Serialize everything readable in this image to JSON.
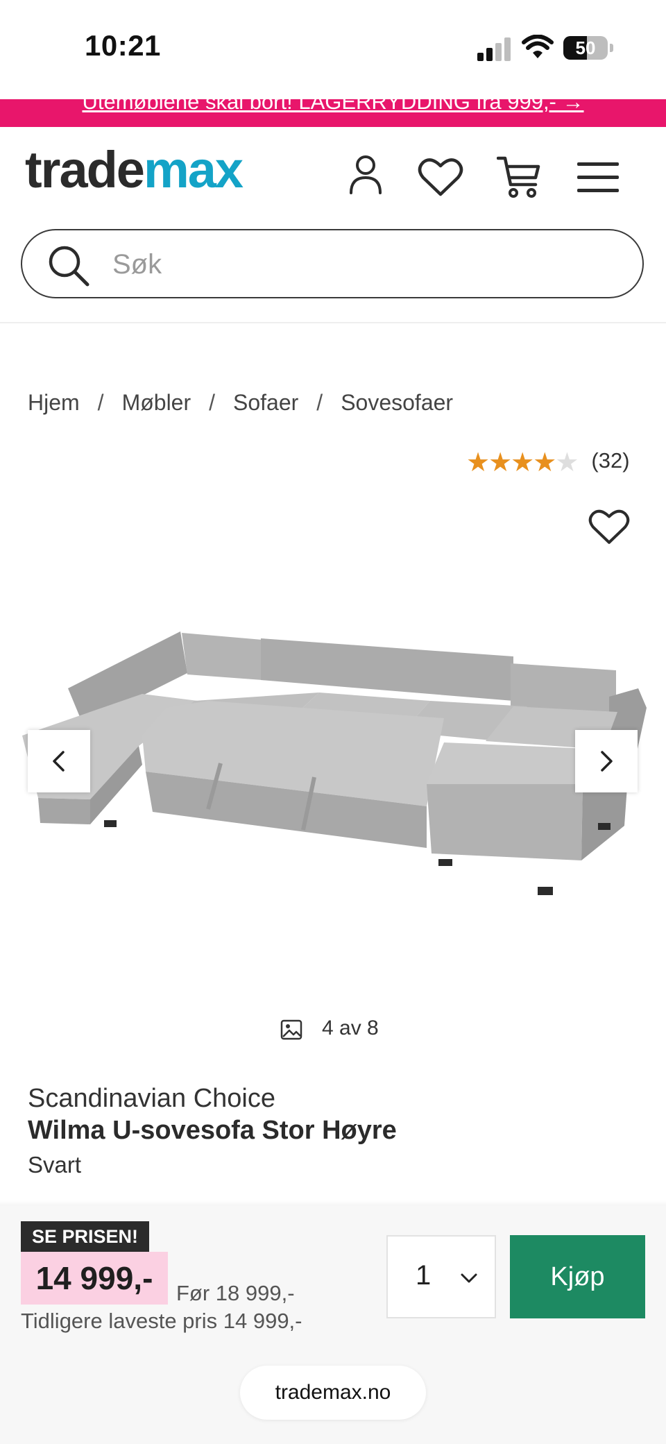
{
  "status_bar": {
    "time": "10:21",
    "battery": "50"
  },
  "promo": {
    "text": "Utemøblene skal bort! LAGERRYDDING fra 999,- →"
  },
  "header": {
    "logo_part1": "trade",
    "logo_part2": "max",
    "icons": [
      "account-icon",
      "heart-icon",
      "cart-icon",
      "menu-icon"
    ]
  },
  "search": {
    "placeholder": "Søk"
  },
  "breadcrumb": {
    "items": [
      "Hjem",
      "Møbler",
      "Sofaer",
      "Sovesofaer"
    ]
  },
  "rating": {
    "stars": 4,
    "max_stars": 5,
    "count": "(32)"
  },
  "gallery": {
    "counter": "4 av 8"
  },
  "product": {
    "brand": "Scandinavian Choice",
    "name": "Wilma U-sovesofa Stor Høyre",
    "variant": "Svart"
  },
  "purchase": {
    "badge": "SE PRISEN!",
    "price": "14 999,-",
    "before_price": "Før 18 999,-",
    "lowest_price": "Tidligere laveste pris 14 999,-",
    "quantity": "1",
    "buy_label": "Kjøp"
  },
  "browser": {
    "url": "trademax.no"
  },
  "colors": {
    "promo": "#e8166b",
    "logo_accent": "#14a3c7",
    "buy": "#1d8a62",
    "price_bg": "#fbd0e2",
    "star": "#e8901e"
  }
}
